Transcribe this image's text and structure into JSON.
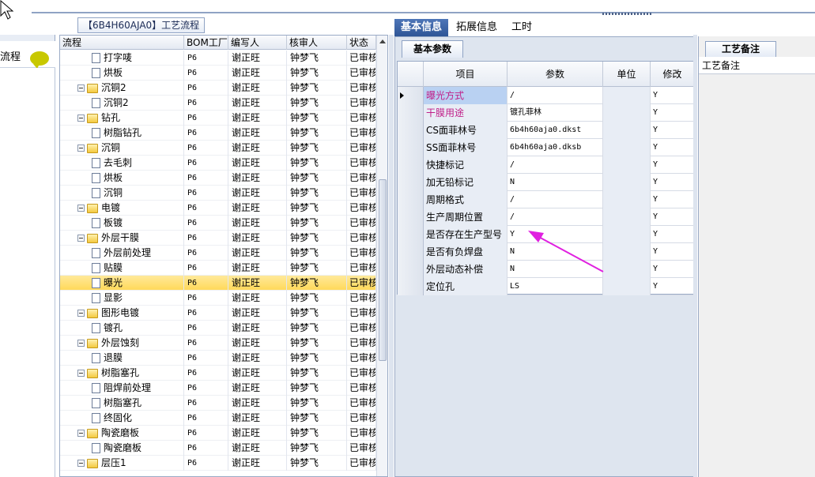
{
  "window": {
    "tree_panel_title": "【6B4H60AJA0】工艺流程",
    "left_panel_label": "流程"
  },
  "tree": {
    "headers": [
      "流程",
      "BOM工厂",
      "编写人",
      "核审人",
      "状态"
    ],
    "rows": [
      {
        "name": "打字唛",
        "type": "doc",
        "level": 2,
        "bom": "P6",
        "writer": "谢正旺",
        "reviewer": "钟梦飞",
        "status": "已审核"
      },
      {
        "name": "烘板",
        "type": "doc",
        "level": 2,
        "bom": "P6",
        "writer": "谢正旺",
        "reviewer": "钟梦飞",
        "status": "已审核"
      },
      {
        "name": "沉铜2",
        "type": "folder",
        "level": 1,
        "bom": "P6",
        "writer": "谢正旺",
        "reviewer": "钟梦飞",
        "status": "已审核"
      },
      {
        "name": "沉铜2",
        "type": "doc",
        "level": 2,
        "bom": "P6",
        "writer": "谢正旺",
        "reviewer": "钟梦飞",
        "status": "已审核"
      },
      {
        "name": "钻孔",
        "type": "folder",
        "level": 1,
        "bom": "P6",
        "writer": "谢正旺",
        "reviewer": "钟梦飞",
        "status": "已审核"
      },
      {
        "name": "树脂钻孔",
        "type": "doc",
        "level": 2,
        "bom": "P6",
        "writer": "谢正旺",
        "reviewer": "钟梦飞",
        "status": "已审核"
      },
      {
        "name": "沉铜",
        "type": "folder",
        "level": 1,
        "bom": "P6",
        "writer": "谢正旺",
        "reviewer": "钟梦飞",
        "status": "已审核"
      },
      {
        "name": "去毛刺",
        "type": "doc",
        "level": 2,
        "bom": "P6",
        "writer": "谢正旺",
        "reviewer": "钟梦飞",
        "status": "已审核"
      },
      {
        "name": "烘板",
        "type": "doc",
        "level": 2,
        "bom": "P6",
        "writer": "谢正旺",
        "reviewer": "钟梦飞",
        "status": "已审核"
      },
      {
        "name": "沉铜",
        "type": "doc",
        "level": 2,
        "bom": "P6",
        "writer": "谢正旺",
        "reviewer": "钟梦飞",
        "status": "已审核"
      },
      {
        "name": "电镀",
        "type": "folder",
        "level": 1,
        "bom": "P6",
        "writer": "谢正旺",
        "reviewer": "钟梦飞",
        "status": "已审核"
      },
      {
        "name": "板镀",
        "type": "doc",
        "level": 2,
        "bom": "P6",
        "writer": "谢正旺",
        "reviewer": "钟梦飞",
        "status": "已审核"
      },
      {
        "name": "外层干膜",
        "type": "folder",
        "level": 1,
        "bom": "P6",
        "writer": "谢正旺",
        "reviewer": "钟梦飞",
        "status": "已审核"
      },
      {
        "name": "外层前处理",
        "type": "doc",
        "level": 2,
        "bom": "P6",
        "writer": "谢正旺",
        "reviewer": "钟梦飞",
        "status": "已审核"
      },
      {
        "name": "贴膜",
        "type": "doc",
        "level": 2,
        "bom": "P6",
        "writer": "谢正旺",
        "reviewer": "钟梦飞",
        "status": "已审核"
      },
      {
        "name": "曝光",
        "type": "doc",
        "level": 2,
        "bom": "P6",
        "writer": "谢正旺",
        "reviewer": "钟梦飞",
        "status": "已审核",
        "selected": true
      },
      {
        "name": "显影",
        "type": "doc",
        "level": 2,
        "bom": "P6",
        "writer": "谢正旺",
        "reviewer": "钟梦飞",
        "status": "已审核"
      },
      {
        "name": "图形电镀",
        "type": "folder",
        "level": 1,
        "bom": "P6",
        "writer": "谢正旺",
        "reviewer": "钟梦飞",
        "status": "已审核"
      },
      {
        "name": "镀孔",
        "type": "doc",
        "level": 2,
        "bom": "P6",
        "writer": "谢正旺",
        "reviewer": "钟梦飞",
        "status": "已审核"
      },
      {
        "name": "外层蚀刻",
        "type": "folder",
        "level": 1,
        "bom": "P6",
        "writer": "谢正旺",
        "reviewer": "钟梦飞",
        "status": "已审核"
      },
      {
        "name": "退膜",
        "type": "doc",
        "level": 2,
        "bom": "P6",
        "writer": "谢正旺",
        "reviewer": "钟梦飞",
        "status": "已审核"
      },
      {
        "name": "树脂塞孔",
        "type": "folder",
        "level": 1,
        "bom": "P6",
        "writer": "谢正旺",
        "reviewer": "钟梦飞",
        "status": "已审核"
      },
      {
        "name": "阻焊前处理",
        "type": "doc",
        "level": 2,
        "bom": "P6",
        "writer": "谢正旺",
        "reviewer": "钟梦飞",
        "status": "已审核"
      },
      {
        "name": "树脂塞孔",
        "type": "doc",
        "level": 2,
        "bom": "P6",
        "writer": "谢正旺",
        "reviewer": "钟梦飞",
        "status": "已审核"
      },
      {
        "name": "终固化",
        "type": "doc",
        "level": 2,
        "bom": "P6",
        "writer": "谢正旺",
        "reviewer": "钟梦飞",
        "status": "已审核"
      },
      {
        "name": "陶瓷磨板",
        "type": "folder",
        "level": 1,
        "bom": "P6",
        "writer": "谢正旺",
        "reviewer": "钟梦飞",
        "status": "已审核"
      },
      {
        "name": "陶瓷磨板",
        "type": "doc",
        "level": 2,
        "bom": "P6",
        "writer": "谢正旺",
        "reviewer": "钟梦飞",
        "status": "已审核"
      },
      {
        "name": "层压1",
        "type": "folder",
        "level": 1,
        "bom": "P6",
        "writer": "谢正旺",
        "reviewer": "钟梦飞",
        "status": "已审核"
      }
    ]
  },
  "tabs": {
    "items": [
      "基本信息",
      "拓展信息",
      "工时"
    ],
    "active": 0
  },
  "basic": {
    "subtab": "基本参数",
    "headers": [
      "项目",
      "参数",
      "单位",
      "修改"
    ],
    "rows": [
      {
        "item": "曝光方式",
        "param": "/",
        "unit": "",
        "mod": "Y",
        "pink": true,
        "highlight": true,
        "current": true
      },
      {
        "item": "干膜用途",
        "param": "镀孔菲林",
        "unit": "",
        "mod": "Y",
        "pink": true
      },
      {
        "item": "CS面菲林号",
        "param": "6b4h60aja0.dkst",
        "unit": "",
        "mod": "Y"
      },
      {
        "item": "SS面菲林号",
        "param": "6b4h60aja0.dksb",
        "unit": "",
        "mod": "Y"
      },
      {
        "item": "快捷标记",
        "param": "/",
        "unit": "",
        "mod": "Y"
      },
      {
        "item": "加无铅标记",
        "param": "N",
        "unit": "",
        "mod": "Y"
      },
      {
        "item": "周期格式",
        "param": "/",
        "unit": "",
        "mod": "Y"
      },
      {
        "item": "生产周期位置",
        "param": "/",
        "unit": "",
        "mod": "Y"
      },
      {
        "item": "是否存在生产型号",
        "param": "Y",
        "unit": "",
        "mod": "Y"
      },
      {
        "item": "是否有负焊盘",
        "param": "N",
        "unit": "",
        "mod": "Y"
      },
      {
        "item": "外层动态补偿",
        "param": "N",
        "unit": "",
        "mod": "Y"
      },
      {
        "item": "定位孔",
        "param": "LS",
        "unit": "",
        "mod": "Y"
      }
    ]
  },
  "notes": {
    "tab": "工艺备注",
    "label": "工艺备注"
  },
  "colors": {
    "accent_tab": "#2e5596",
    "selected_row": "#ffd95a",
    "pink_text": "#c0208a",
    "annotation_arrow": "#e020e0"
  }
}
